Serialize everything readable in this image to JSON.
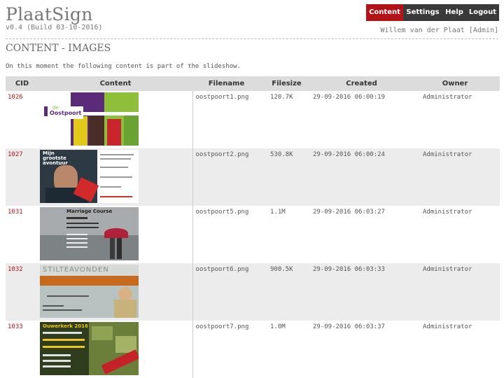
{
  "app": {
    "logo": "PlaatSign",
    "version": "v0.4 (Build 03-10-2016)"
  },
  "nav": {
    "items": [
      {
        "label": "Content",
        "active": true
      },
      {
        "label": "Settings",
        "active": false
      },
      {
        "label": "Help",
        "active": false
      },
      {
        "label": "Logout",
        "active": false
      }
    ]
  },
  "user": {
    "label": "Willem van der Plaat [Admin]"
  },
  "page": {
    "title": "CONTENT - IMAGES",
    "intro": "On this moment the following content is part of the slideshow."
  },
  "table": {
    "headers": {
      "cid": "CID",
      "content": "Content",
      "filename": "Filename",
      "filesize": "Filesize",
      "created": "Created",
      "owner": "Owner"
    },
    "rows": [
      {
        "cid": "1026",
        "filename": "oostpoort1.png",
        "filesize": "120.7K",
        "created": "29-09-2016 06:00:19",
        "owner": "Administrator",
        "thumb": "oostpoort-logo"
      },
      {
        "cid": "1027",
        "filename": "oostpoort2.png",
        "filesize": "530.8K",
        "created": "29-09-2016 06:00:24",
        "owner": "Administrator",
        "thumb": "poster-man"
      },
      {
        "cid": "1031",
        "filename": "oostpoort5.png",
        "filesize": "1.1M",
        "created": "29-09-2016 06:03:27",
        "owner": "Administrator",
        "thumb": "marriage-course"
      },
      {
        "cid": "1032",
        "filename": "oostpoort6.png",
        "filesize": "900.5K",
        "created": "29-09-2016 06:03:33",
        "owner": "Administrator",
        "thumb": "stiltavonden"
      },
      {
        "cid": "1033",
        "filename": "oostpoort7.png",
        "filesize": "1.0M",
        "created": "29-09-2016 06:03:37",
        "owner": "Administrator",
        "thumb": "ouwerkerk"
      }
    ]
  },
  "thumbs": {
    "t1": {
      "brand": "Oostpoort",
      "prefix": "de"
    },
    "t2": {
      "headline": "Mijn grootste avontuur"
    },
    "t3": {
      "headline": "Marriage Course"
    },
    "t4": {
      "headline": "STILTEAVONDEN"
    },
    "t5": {
      "headline": "Ouwerkerk 2016"
    }
  },
  "colors": {
    "accent": "#b31217",
    "nav_inactive": "#3a3a3a",
    "header_bg": "#dcdcdc",
    "row_alt": "#ececec"
  }
}
